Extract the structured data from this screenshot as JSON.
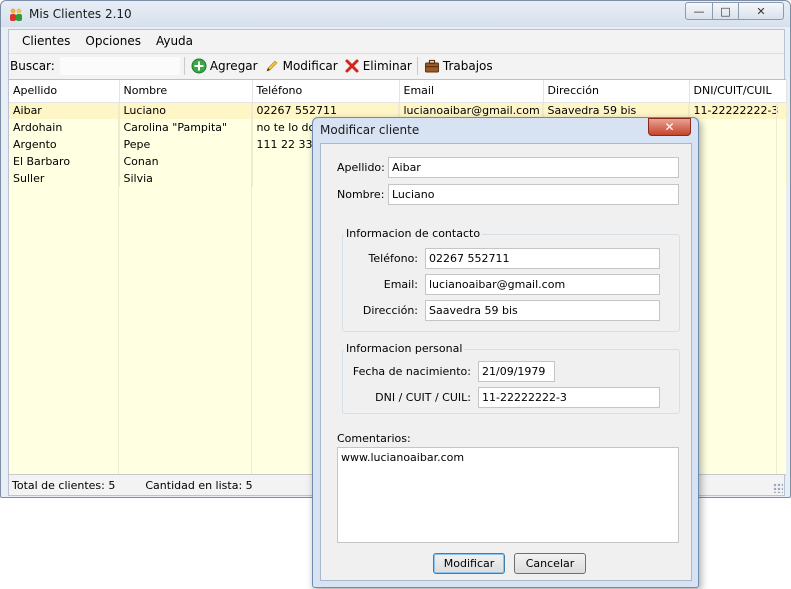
{
  "window": {
    "title": "Mis Clientes 2.10",
    "minimize": "—",
    "maximize": "□",
    "close": "✕"
  },
  "menu": {
    "items": [
      "Clientes",
      "Opciones",
      "Ayuda"
    ]
  },
  "toolbar": {
    "search_label": "Buscar:",
    "search_value": "",
    "add_label": "Agregar",
    "edit_label": "Modificar",
    "delete_label": "Eliminar",
    "jobs_label": "Trabajos",
    "icons": [
      "plus-circle-icon",
      "pencil-icon",
      "red-x-icon",
      "briefcase-icon"
    ]
  },
  "grid": {
    "columns": [
      "Apellido",
      "Nombre",
      "Teléfono",
      "Email",
      "Dirección",
      "DNI/CUIT/CUIL"
    ],
    "rows": [
      [
        "Aibar",
        "Luciano",
        "02267 552711",
        "lucianoaibar@gmail.com",
        "Saavedra 59 bis",
        "11-22222222-3"
      ],
      [
        "Ardohain",
        "Carolina \"Pampita\"",
        "no te lo doy",
        "",
        "",
        ""
      ],
      [
        "Argento",
        "Pepe",
        "111 22 333",
        "",
        "",
        ""
      ],
      [
        "El Barbaro",
        "Conan",
        "",
        "",
        "",
        ""
      ],
      [
        "Suller",
        "Silvia",
        "",
        "",
        "",
        ""
      ]
    ]
  },
  "status": {
    "total": "Total de clientes: 5",
    "list": "Cantidad en lista: 5"
  },
  "dialog": {
    "title": "Modificar cliente",
    "close": "✕",
    "apellido_label": "Apellido:",
    "apellido": "Aibar",
    "nombre_label": "Nombre:",
    "nombre": "Luciano",
    "contact_group": "Informacion de contacto",
    "telefono_label": "Teléfono:",
    "telefono": "02267 552711",
    "email_label": "Email:",
    "email": "lucianoaibar@gmail.com",
    "direccion_label": "Dirección:",
    "direccion": "Saavedra 59 bis",
    "personal_group": "Informacion personal",
    "fecha_label": "Fecha de nacimiento:",
    "fecha": "21/09/1979",
    "dni_label": "DNI / CUIT / CUIL:",
    "dni": "11-22222222-3",
    "comments_label": "Comentarios:",
    "comments": "www.lucianoaibar.com",
    "ok_label": "Modificar",
    "cancel_label": "Cancelar"
  },
  "colors": {
    "grid_background": "#ffffe1",
    "selected_row": "#fff6c8",
    "close_button": "#c6432c"
  }
}
